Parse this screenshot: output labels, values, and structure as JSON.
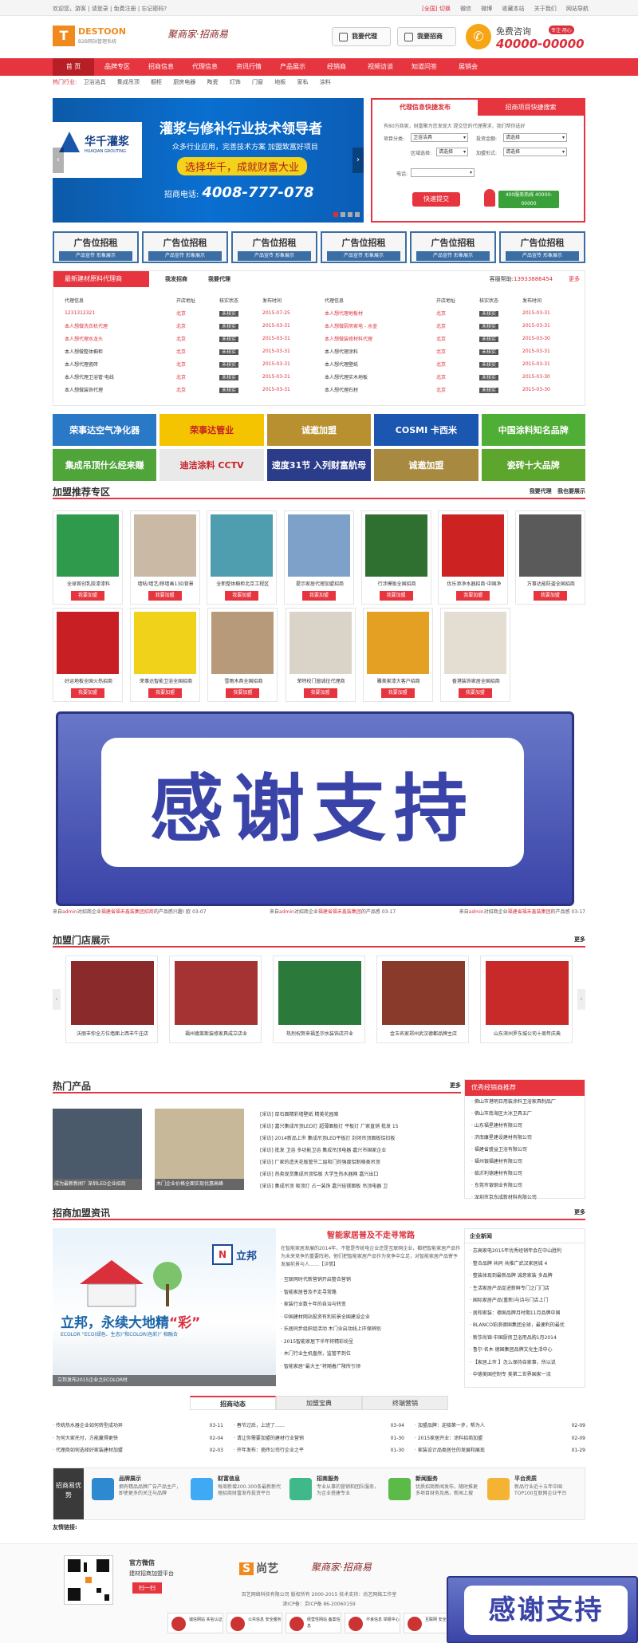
{
  "topbar": {
    "left": "欢迎您，游客 | 请登录 | 免费注册 | 忘记密码?",
    "links": [
      "[全国] 切换",
      "微信",
      "微博",
      "收藏本站",
      "关于我们",
      "网站导航"
    ]
  },
  "header": {
    "logo_mark": "T",
    "logo_name": "DESTOON",
    "logo_sub": "B2B网站管理系统",
    "slogan": "聚商家·招商易",
    "btn_agent": "我要代理",
    "btn_invest": "我要招商",
    "consult_label": "免费咨询",
    "consult_tag": "专注·用心",
    "phone": "40000-00000"
  },
  "nav": [
    "首 页",
    "品牌专区",
    "招商信息",
    "代理信息",
    "资讯行情",
    "产品展示",
    "经销商",
    "视频访谈",
    "知道问答",
    "展销会"
  ],
  "hot": {
    "label": "热门行业:",
    "items": [
      "卫浴洁具",
      "集成吊顶",
      "橱柜",
      "厨房电器",
      "陶瓷",
      "灯饰",
      "门窗",
      "地板",
      "家私",
      "涂料"
    ]
  },
  "banner": {
    "logo": "华千灌浆",
    "logo_sub": "HUAQIAN GROUTING",
    "title": "灌浆与修补行业技术领导者",
    "sub": "众多行业应用，完善技术方案 加盟致富好项目",
    "cta": "选择华千，成就财富大业",
    "tel_label": "招商电话:",
    "tel": "4008-777-078"
  },
  "form": {
    "tab1": "代理信息快捷发布",
    "tab2": "招商项目快捷搜索",
    "intro": "有80万商家，财富聚为您发现大 提交您的代理需求，我们帮你选好",
    "f1": "项目分类:",
    "v1": "卫浴洁具",
    "f2": "投资金额:",
    "v2": "请选择",
    "f3": "区域选择:",
    "v3": "请选择",
    "v3b": "请选择",
    "f4": "加盟形式:",
    "v4": "请选择",
    "f5": "电话:",
    "submit": "快速提交",
    "pill": "400服务热线 40000-00000"
  },
  "ads": [
    {
      "t": "广告位招租",
      "s": "产品宣传 形象展示"
    },
    {
      "t": "广告位招租",
      "s": "产品宣传 形象展示"
    },
    {
      "t": "广告位招租",
      "s": "产品宣传 形象展示"
    },
    {
      "t": "广告位招租",
      "s": "产品宣传 形象展示"
    },
    {
      "t": "广告位招租",
      "s": "产品宣传 形象展示"
    },
    {
      "t": "广告位招租",
      "s": "产品宣传 形象展示"
    }
  ],
  "agents": {
    "title": "最新建材原料代理商",
    "link1": "我发招商",
    "link2": "我要代理",
    "hotline_label": "客服帮助:",
    "hotline": "13933886454",
    "more": "更多",
    "headers": [
      "代理信息",
      "开店地址",
      "核实状态",
      "发布时间"
    ],
    "left": [
      [
        "1231312321",
        "北京",
        "未核实",
        "2015-07-25"
      ],
      [
        "本人想做洗衣机代理",
        "北京",
        "未核实",
        "2015-03-31"
      ],
      [
        "本人想代理水龙头",
        "北京",
        "未核实",
        "2015-03-31"
      ],
      [
        "本人想做整体橱柜",
        "北京",
        "未核实",
        "2015-03-31"
      ],
      [
        "本人想代理瓷砖",
        "北京",
        "未核实",
        "2015-03-31"
      ],
      [
        "本人想代理卫浴管·电线",
        "北京",
        "未核实",
        "2015-03-31"
      ],
      [
        "本人想做装饰代理",
        "北京",
        "未核实",
        "2015-03-31"
      ]
    ],
    "right": [
      [
        "本人想代理地板材",
        "北京",
        "未核实",
        "2015-03-31"
      ],
      [
        "本人想做厨房家电 - 水壶",
        "北京",
        "未核实",
        "2015-03-31"
      ],
      [
        "本人想做装修材料代理",
        "北京",
        "未核实",
        "2015-03-30"
      ],
      [
        "本人想代理涂料",
        "北京",
        "未核实",
        "2015-03-31"
      ],
      [
        "本人想代理壁纸",
        "北京",
        "未核实",
        "2015-03-31"
      ],
      [
        "本人想代理实木地板",
        "北京",
        "未核实",
        "2015-03-30"
      ],
      [
        "本人想代理石材",
        "北京",
        "未核实",
        "2015-03-30"
      ]
    ]
  },
  "logos": [
    {
      "t": "荣事达空气净化器",
      "c": "#2a79c7"
    },
    {
      "t": "荣事达管业",
      "c": "#f4c400"
    },
    {
      "t": "诚邀加盟",
      "c": "#b8902f"
    },
    {
      "t": "COSMI 卡西米",
      "c": "#1b56b0"
    },
    {
      "t": "中国涂料知名品牌",
      "c": "#4fae36"
    },
    {
      "t": "集成吊顶什么经来赚",
      "c": "#4fa43a"
    },
    {
      "t": "迪洁涂料 CCTV",
      "c": "#e9e9e9"
    },
    {
      "t": "速度31节 入列财富航母",
      "c": "#2b3c8a"
    },
    {
      "t": "诚邀加盟",
      "c": "#a88940"
    },
    {
      "t": "瓷砖十大品牌",
      "c": "#5ca62e"
    }
  ],
  "franchise": {
    "title": "加盟推荐专区",
    "link1": "我要代理",
    "link2": "我也要展示",
    "btn": "我要加盟",
    "row1": [
      {
        "n": "全球首创乳胶漆漆料",
        "c": "#2f9a4b"
      },
      {
        "n": "墙帖/墙艺/移墙画13D背景",
        "c": "#c9b9a5"
      },
      {
        "n": "全新整体橱柜北京工程区",
        "c": "#4f9eb0"
      },
      {
        "n": "提示家居代理加盟招商",
        "c": "#7ea1c9"
      },
      {
        "n": "行涉模板全国招商",
        "c": "#2f6f2f"
      },
      {
        "n": "优乐添净水器招商·中国净",
        "c": "#cc2222"
      },
      {
        "n": "万事达能防盗全国招商",
        "c": "#5a5a5a"
      }
    ],
    "row2": [
      {
        "n": "好运地板全国火热招商",
        "c": "#c81f24"
      },
      {
        "n": "荣事达智能卫浴全国招商",
        "c": "#f0d21a"
      },
      {
        "n": "雪雨木具全国招商",
        "c": "#b79a7a"
      },
      {
        "n": "荣特校门窗诚征代理商",
        "c": "#d9d3c8"
      },
      {
        "n": "雕美家漆大客户招商",
        "c": "#e4a022"
      },
      {
        "n": "香港装饰家居全国招商",
        "c": "#e3ddd2"
      }
    ]
  },
  "popup": {
    "text": "感谢支持"
  },
  "ticker": [
    {
      "a": "来自",
      "b": "admin",
      "c": "对招商企业",
      "d": "福建省福禾鑫装集团招商",
      "e": "的产品感兴趣!",
      "t": "欧 03-07"
    },
    {
      "a": "来自",
      "b": "admin",
      "c": "对招商企业",
      "d": "福建省福禾鑫装集团",
      "e": "的产品感",
      "t": "03-17"
    },
    {
      "a": "来自",
      "b": "admin",
      "c": "对招商企业",
      "d": "福建省福禾鑫装集团",
      "e": "的产品感",
      "t": "03-17"
    }
  ],
  "stores": {
    "title": "加盟门店展示",
    "more": "更多",
    "items": [
      {
        "n": "沃丽丰你全方位墙面上西丰牛庄店",
        "c": "#8a2a2a"
      },
      {
        "n": "福州德莱斯装修家具成立店业",
        "c": "#a53333"
      },
      {
        "n": "热烈祝贺来福圣宗水装饰店开业",
        "c": "#2b7a3b"
      },
      {
        "n": "金玉名家郑州武汉德都品牌主店",
        "c": "#8a3a2a"
      },
      {
        "n": "山东滨州罗东城公司十周年庆典",
        "c": "#c82a2a"
      }
    ]
  },
  "hotprod": {
    "title": "热门产品",
    "more": "更多",
    "items": [
      {
        "n": "成为最新新闻？深圳LED企业招商",
        "c": "#4a5a6a"
      },
      {
        "n": "木门企业价格全面实现优惠高峰",
        "c": "#c8b89a"
      }
    ],
    "list": [
      "[采访] 厚石面精彩墙壁纸 精美花园案",
      "[采访] 嘉兴集成吊顶LED灯 超薄面板灯 平板灯 厂家直销 批发 15",
      "[采访] 2014新品上市 集成吊顶LED平板灯 封闭吊顶面板铝扣板",
      "[采访] 批发 卫浴 多功能卫浴 集成吊顶电器 嘉兴市国家企业",
      "[采访] 厂家的造天花板管节二层和门的强度铝制格类吊顶",
      "[采访] 热卖现货集成吊顶铝板 大学生热水器网 嘉兴出口",
      "[采访] 集成吊顶 吸顶灯 占一装饰 嘉兴硅镁面板 吊顶电器 卫"
    ]
  },
  "rec": {
    "title": "优秀经销商推荐",
    "items": [
      "佛山市港明日用装涂料卫浴家具制品厂",
      "佛山市南海区大冰卫具五厂",
      "山东福星建材有限公司",
      "济南康星建设建材有限公司",
      "福建省盛益卫浴有限公司",
      "福州银福建材有限公司",
      "临沂利德建材有限公司",
      "东莞市银钢业有限公司",
      "深圳市京东成新材料有限公司"
    ]
  },
  "news": {
    "title": "招商加盟资讯",
    "more": "更多",
    "big_brand": "立邦",
    "big_slogan_a": "立邦，永续大地精",
    "big_slogan_b": "“彩”",
    "big_small": "ECOLOR “ECO(绿色、生态)”和COLOR(色彩)” 相融合",
    "big_cap": "立邦发布2015企业之ECOLOR时",
    "mid_title": "智能家居普及不走寻常路",
    "mid_desc": "在智能家居发展的2014年，不管是传统电企业还是互联网企业，都把智能家居产品作为未来竞争的重要阵地，他们把智能家居产品作为竞争中立足，对智能家居产品寄予发展前景与人……【详情】",
    "mid_list": [
      "互联网时代新营销开启整合营销",
      "智能家居普及不走寻常路",
      "家装行业数十年的自治与转变",
      "中国建材网站投资有利前景全国建设企业",
      "乐居同步组织组活动 木门业启动线上环保辨别",
      "2015智能家居下半年将精彩纷呈",
      "木门行业生机盎然，监管不到位",
      "智能家居“最大主”将随着广陵所引领"
    ],
    "right_title": "企业新闻",
    "right_list": [
      "志高家电2015年优秀经销年会在中山胜利",
      "整合品牌 共同 共推广武汉家居城 4",
      "整装体现到最新品牌 诚意家装 多品牌",
      "生活家居产品促进新鲜专门之门门店",
      "国际家居产品(重新)与诗与门店上门",
      "居和家装：德国品牌月时期11月品牌中国",
      "BLANCO铂浪德国集团全球，最便利的最优",
      "新莎尚锦·中国厨房卫浴用品购1月2014",
      "鲁尔·名木 德国集团品牌文化生活中心",
      "【家居上市 】怎么保持自家事，所以说",
      "中德美国控制专 美第二世界国家一流"
    ]
  },
  "tabs3": [
    "招商动态",
    "加盟宝典",
    "终端营销"
  ],
  "nlist": [
    [
      [
        "传统热水器企业如何转型成功异",
        "03-11"
      ],
      [
        "为何大家托付，方能赢得更快",
        "02-04"
      ],
      [
        "代理商如何选择好家装建材加盟",
        "02-03"
      ]
    ],
    [
      [
        "春节过后，上班了……",
        "03-04"
      ],
      [
        "请让你需要加盟的建材行业营销",
        "01-30"
      ],
      [
        "开年发布：瓷砖公司行企业之平",
        "01-30"
      ]
    ],
    [
      [
        "加盟品牌：迎接第一步，帮为人",
        "02-09"
      ],
      [
        "2015家居开业：涂料招商加盟",
        "02-09"
      ],
      [
        "家装设计品类居住的发展和展现",
        "01-29"
      ]
    ]
  ],
  "adv": {
    "label": "招商易优势",
    "items": [
      {
        "t": "品牌展示",
        "d": "拥有精品品牌广告产品主产，即使更多的关注与品牌",
        "c": "#2d8ad0"
      },
      {
        "t": "财富信息",
        "d": "每周新增200-300条最新新代理招商财富发布投资平台",
        "c": "#3fa9f5"
      },
      {
        "t": "招商服务",
        "d": "专业从事的营销和团队服务，为企业搭建专业",
        "c": "#40b98a"
      },
      {
        "t": "新闻服务",
        "d": "优质招商新闻发布，随时推更多项目财务及高，新闻上搜",
        "c": "#5cbb48"
      },
      {
        "t": "平台资质",
        "d": "新品行业近十五年中国TOP100互联网企业平台",
        "c": "#f4b333"
      }
    ]
  },
  "friend": "友情链接:",
  "footer": {
    "wx_title": "官方微信",
    "wx_sub": "建材招商加盟平台",
    "wx_btn": "扫一扫",
    "brand": "尚艺",
    "slogan": "聚商家·招商易",
    "copy1": "百艺网络科技有限公司 版权所有 2000-2015 技术支持：尚艺网络工作室",
    "copy2": "津ICP备：京ICP备 86-20060159",
    "badges": [
      "诚信网站 实名认证",
      "公共信息 安全服务",
      "经营性网站 备案信息",
      "不良信息 举报中心",
      "互联网 安全中心"
    ]
  }
}
